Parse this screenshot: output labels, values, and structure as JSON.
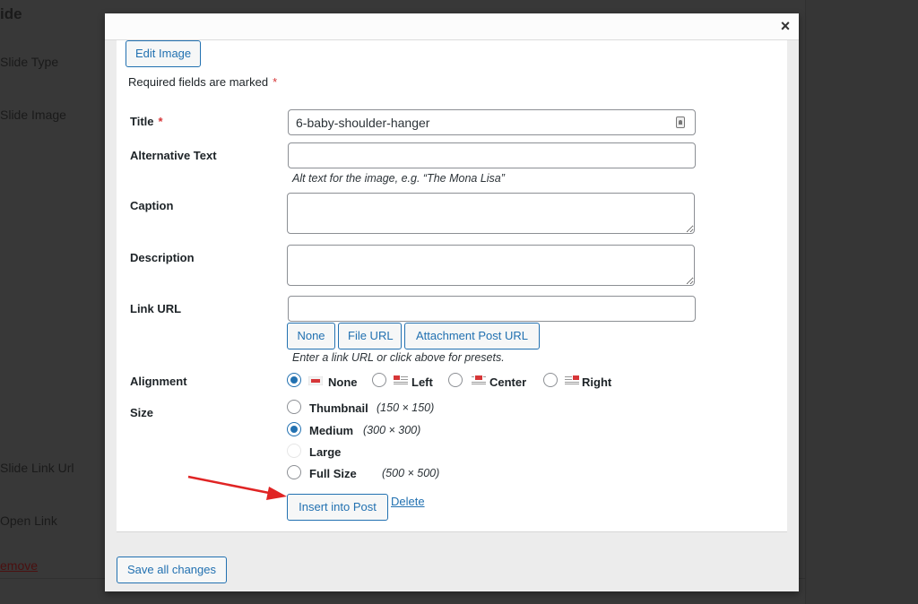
{
  "background": {
    "heading": "ide",
    "fields": [
      "Slide Type",
      "Slide Image",
      "Slide Link Url",
      "Open Link"
    ],
    "remove_link": "emove"
  },
  "modal": {
    "close_icon": "×",
    "edit_image_label": "Edit Image",
    "required_note": "Required fields are marked",
    "required_marker": "*",
    "fields": {
      "title": {
        "label": "Title",
        "value": "6-baby-shoulder-hanger"
      },
      "alt_text": {
        "label": "Alternative Text",
        "value": "",
        "hint": "Alt text for the image, e.g. “The Mona Lisa”"
      },
      "caption": {
        "label": "Caption",
        "value": ""
      },
      "description": {
        "label": "Description",
        "value": ""
      },
      "link_url": {
        "label": "Link URL",
        "value": "",
        "presets": [
          "None",
          "File URL",
          "Attachment Post URL"
        ],
        "hint": "Enter a link URL or click above for presets."
      }
    },
    "alignment": {
      "label": "Alignment",
      "options": [
        "None",
        "Left",
        "Center",
        "Right"
      ],
      "selected": "None"
    },
    "size": {
      "label": "Size",
      "options": [
        {
          "label": "Thumbnail",
          "dims": "(150 × 150)",
          "state": "unchecked"
        },
        {
          "label": "Medium",
          "dims": "(300 × 300)",
          "state": "checked"
        },
        {
          "label": "Large",
          "dims": "",
          "state": "disabled"
        },
        {
          "label": "Full Size",
          "dims": "(500 × 500)",
          "state": "unchecked"
        }
      ]
    },
    "insert_label": "Insert into Post",
    "delete_label": "Delete",
    "save_all_label": "Save all changes"
  },
  "colors": {
    "accent": "#2271b1",
    "required": "#d63638",
    "annotation_arrow": "#e02424"
  }
}
